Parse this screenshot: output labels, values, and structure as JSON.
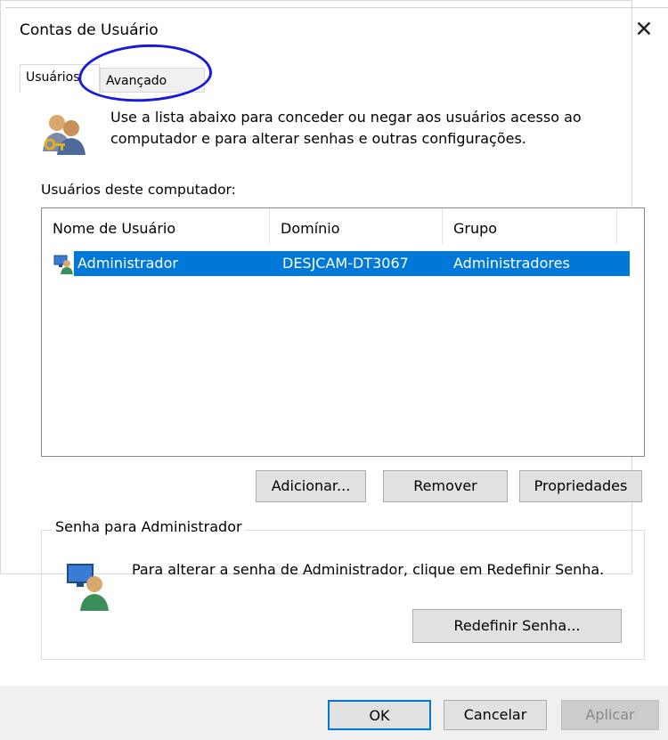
{
  "window": {
    "title": "Contas de Usuário"
  },
  "tabs": [
    {
      "label": "Usuários"
    },
    {
      "label": "Avançado"
    }
  ],
  "intro": {
    "text_line1": "Use a lista abaixo para conceder ou negar aos usuários acesso ao",
    "text_line2": "computador e para alterar senhas e outras configurações."
  },
  "users_section": {
    "label": "Usuários deste computador:",
    "columns": [
      "Nome de Usuário",
      "Domínio",
      "Grupo"
    ],
    "rows": [
      {
        "name": "Administrador",
        "domain": "DESJCAM-DT3067",
        "group": "Administradores"
      }
    ]
  },
  "list_buttons": {
    "add": "Adicionar...",
    "remove": "Remover",
    "properties": "Propriedades"
  },
  "password_group": {
    "label": "Senha para Administrador",
    "text": "Para alterar a senha de Administrador, clique em Redefinir Senha.",
    "reset_button": "Redefinir Senha..."
  },
  "footer": {
    "ok": "OK",
    "cancel": "Cancelar",
    "apply": "Aplicar"
  },
  "colors": {
    "selection": "#0078d7",
    "annotation": "#1a1ad9"
  }
}
